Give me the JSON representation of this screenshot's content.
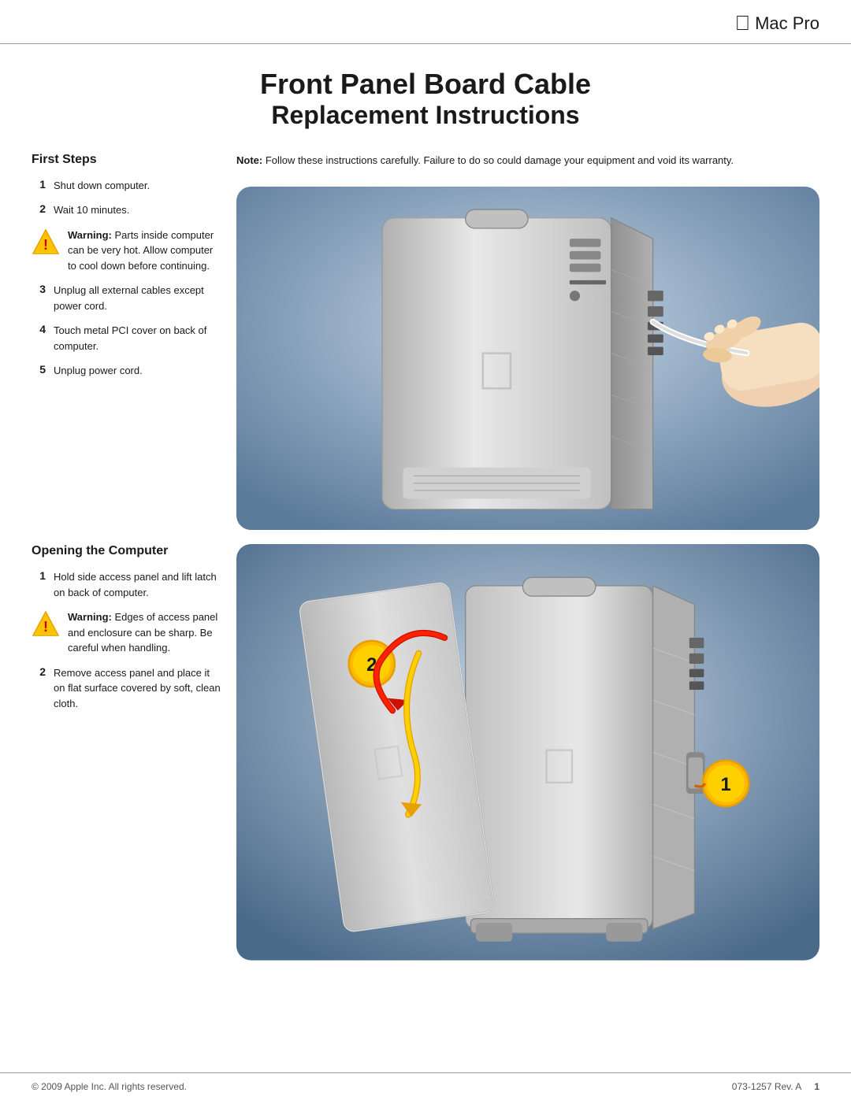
{
  "header": {
    "apple_symbol": "",
    "product": "Mac Pro"
  },
  "title": {
    "line1": "Front Panel Board Cable",
    "line2": "Replacement Instructions"
  },
  "first_steps": {
    "heading": "First Steps",
    "note_label": "Note:",
    "note_text": "Follow these instructions carefully. Failure to do so could damage your equipment and void its warranty.",
    "steps": [
      {
        "number": "1",
        "text": "Shut down computer."
      },
      {
        "number": "2",
        "text": "Wait 10 minutes."
      },
      {
        "number": "warning",
        "bold": "Warning:",
        "rest": " Parts inside computer can be very hot. Allow computer to cool down before continuing."
      },
      {
        "number": "3",
        "text": "Unplug all external cables except power cord."
      },
      {
        "number": "4",
        "text": "Touch metal PCI cover on back of computer."
      },
      {
        "number": "5",
        "text": "Unplug power cord."
      }
    ]
  },
  "opening": {
    "heading": "Opening the Computer",
    "steps": [
      {
        "number": "1",
        "text": "Hold side access panel and lift latch on back of computer."
      },
      {
        "number": "warning",
        "bold": "Warning:",
        "rest": " Edges of access panel and enclosure can be sharp. Be careful when handling."
      },
      {
        "number": "2",
        "text": "Remove access panel and place it on flat surface covered by soft, clean cloth."
      }
    ]
  },
  "footer": {
    "copyright": "© 2009 Apple Inc. All rights reserved.",
    "doc_number": "073-1257 Rev. A",
    "page": "1"
  }
}
